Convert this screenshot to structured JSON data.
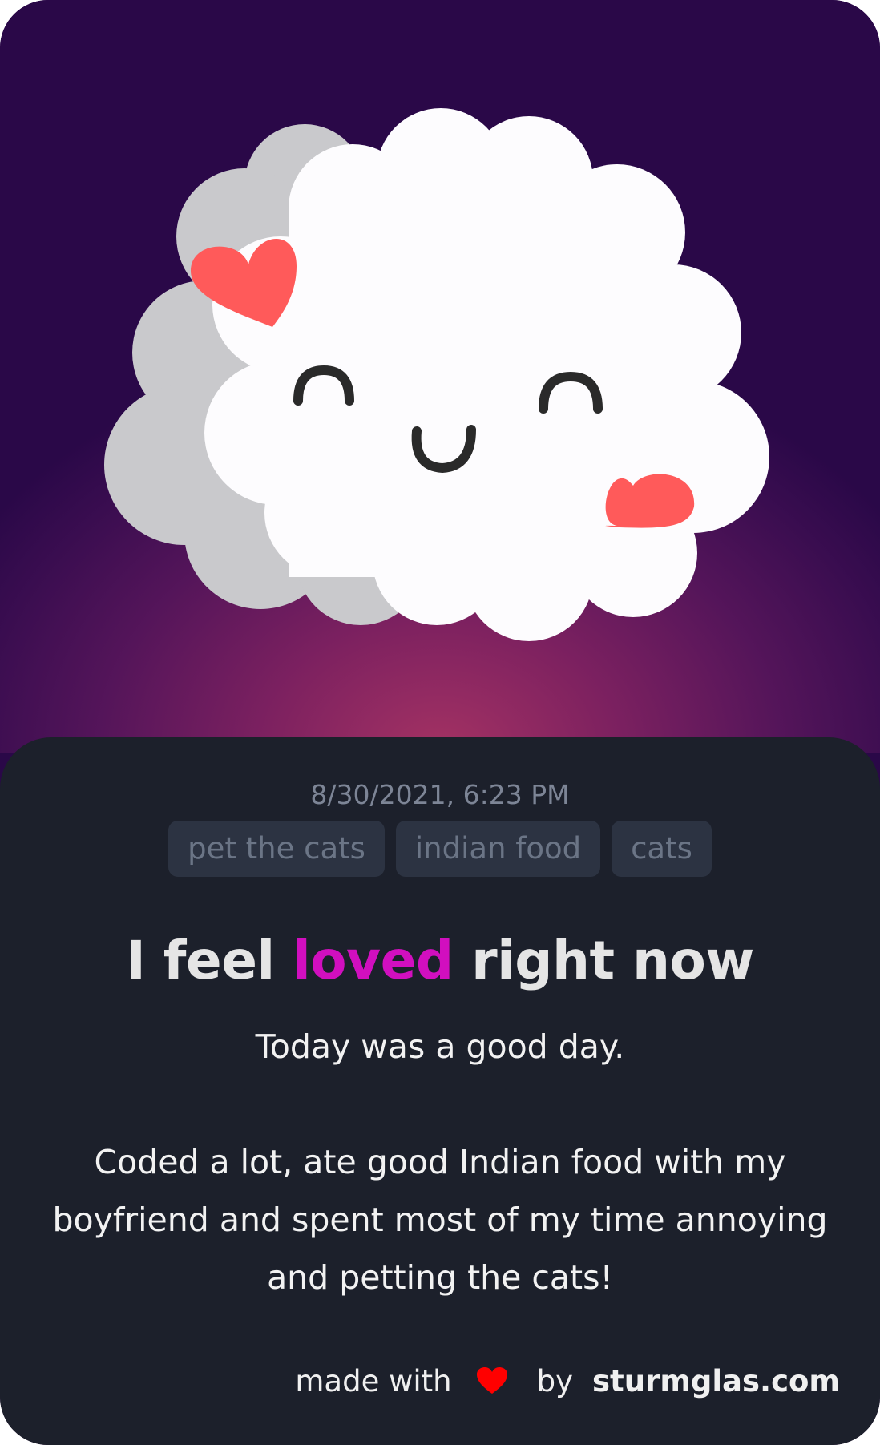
{
  "entry": {
    "timestamp": "8/30/2021, 6:23 PM",
    "tags": [
      "pet the cats",
      "indian food",
      "cats"
    ],
    "headline": {
      "prefix": "I feel",
      "mood": "loved",
      "suffix": "right now"
    },
    "body": {
      "line1": "Today was a good day.",
      "paragraph2": "Coded a lot, ate good Indian food with my boyfriend and spent most of my time annoying and petting the cats!"
    }
  },
  "footer": {
    "made_with": "made with",
    "by": "by",
    "brand": "sturmglas.com"
  },
  "illustration": {
    "icon": "happy-cloud-with-hearts-icon"
  },
  "colors": {
    "mood_accent": "#d10fbf",
    "panel_background": "#1c202b",
    "tag_background": "#2c3342",
    "heart": "#ff5a5a",
    "footer_heart": "#ff0000"
  }
}
